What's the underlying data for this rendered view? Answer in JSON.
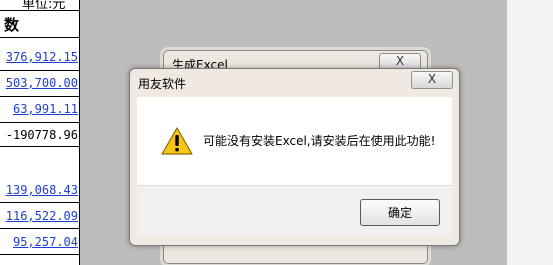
{
  "sheet": {
    "unit_label": "单位:元",
    "column_title": "数",
    "cells": [
      {
        "text": "376,912.15",
        "style": "link"
      },
      {
        "text": "503,700.00",
        "style": "link"
      },
      {
        "text": "63,991.11",
        "style": "link"
      },
      {
        "text": "-190778.96",
        "style": "plain"
      },
      {
        "text": "139,068.43",
        "style": "link"
      },
      {
        "text": "116,522.09",
        "style": "link"
      },
      {
        "text": "95,257.04",
        "style": "link"
      }
    ]
  },
  "background_dialog": {
    "title": "生成Excel",
    "close_glyph": "X"
  },
  "dialog": {
    "title": "用友软件",
    "close_glyph": "X",
    "icon": "warning-icon",
    "message": "可能没有安装Excel,请安装后在使用此功能!",
    "ok_label": "确定"
  },
  "colors": {
    "workspace": "#bdbdbd",
    "link": "#1f3fd0",
    "warning_yellow": "#f5c518"
  }
}
